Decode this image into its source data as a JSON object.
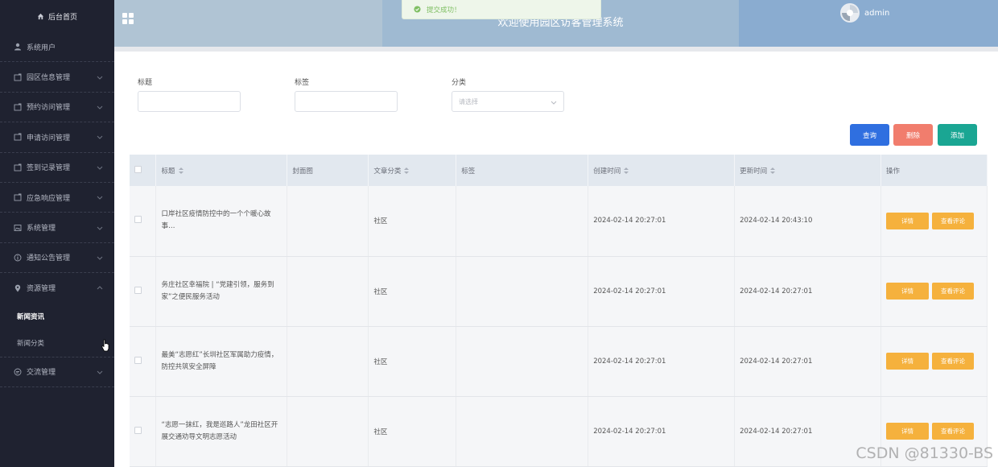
{
  "header": {
    "title": "欢迎使用园区访客管理系统",
    "toast": "提交成功！",
    "username": "admin"
  },
  "sidebar": {
    "home": "后台首页",
    "items": [
      {
        "label": "系统用户",
        "icon": "user-icon"
      },
      {
        "label": "园区信息管理",
        "icon": "folder-icon"
      },
      {
        "label": "预约访问管理",
        "icon": "folder-icon"
      },
      {
        "label": "申请访问管理",
        "icon": "folder-icon"
      },
      {
        "label": "签到记录管理",
        "icon": "folder-icon"
      },
      {
        "label": "应急响应管理",
        "icon": "folder-icon"
      },
      {
        "label": "系统管理",
        "icon": "image-icon"
      },
      {
        "label": "通知公告管理",
        "icon": "info-icon"
      },
      {
        "label": "资源管理",
        "icon": "location-icon"
      },
      {
        "label": "交流管理",
        "icon": "chat-icon"
      }
    ],
    "submenu": [
      "新闻资讯",
      "新闻分类"
    ]
  },
  "filters": {
    "title_label": "标题",
    "tag_label": "标签",
    "category_label": "分类",
    "category_placeholder": "请选择"
  },
  "buttons": {
    "search": "查询",
    "delete": "删除",
    "add": "添加"
  },
  "colors": {
    "search": "#2f6fe0",
    "delete": "#f17d6d",
    "add": "#1aa693",
    "action": "#f5b13d",
    "sidebar": "#1f2230"
  },
  "table": {
    "columns": [
      "标题",
      "封面图",
      "文章分类",
      "标签",
      "创建时间",
      "更新时间",
      "操作"
    ],
    "rows": [
      {
        "title": "口岸社区疫情防控中的一个个暖心故事…",
        "cover": "",
        "category": "社区",
        "tag": "",
        "created": "2024-02-14 20:27:01",
        "updated": "2024-02-14 20:43:10"
      },
      {
        "title": "务庄社区幸福院 | “党建引领，服务到家”之便民服务活动",
        "cover": "",
        "category": "社区",
        "tag": "",
        "created": "2024-02-14 20:27:01",
        "updated": "2024-02-14 20:27:01"
      },
      {
        "title": "最美“志愿红”长圳社区军属助力疫情，防控共筑安全屏障",
        "cover": "",
        "category": "社区",
        "tag": "",
        "created": "2024-02-14 20:27:01",
        "updated": "2024-02-14 20:27:01"
      },
      {
        "title": "“志愿一抹红，我是巡路人”龙田社区开展交通劝导文明志愿活动",
        "cover": "",
        "category": "社区",
        "tag": "",
        "created": "2024-02-14 20:27:01",
        "updated": "2024-02-14 20:27:01"
      }
    ],
    "actions": {
      "detail": "详情",
      "comments": "查看评论"
    }
  },
  "watermark": "CSDN @81330-BS"
}
